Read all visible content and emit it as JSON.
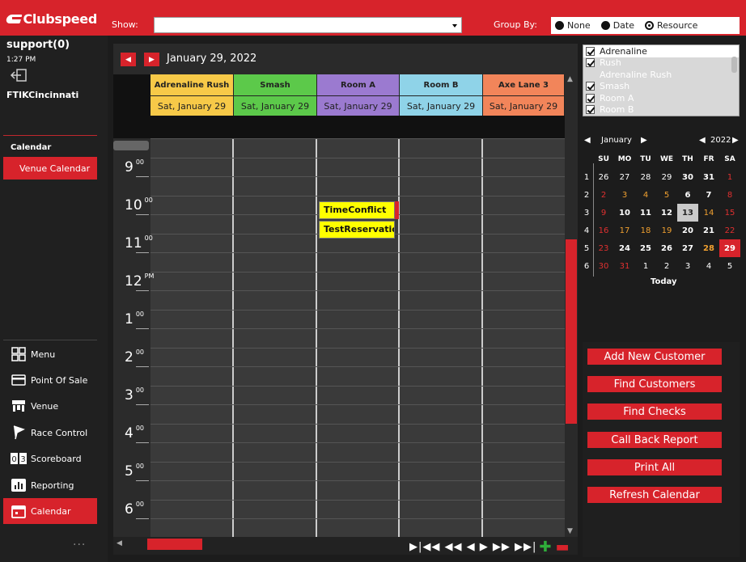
{
  "brand": {
    "name": "Clubspeed",
    "color": "#d7232b"
  },
  "header": {
    "show_label": "Show:",
    "show_value": "",
    "group_by_label": "Group By:",
    "group_by_options": [
      "None",
      "Date",
      "Resource"
    ],
    "group_by_selected": "Resource"
  },
  "sidebar": {
    "user": "support(0)",
    "time": "1:27 PM",
    "location": "FTIKCincinnati",
    "calendar_header": "Calendar",
    "venue_calendar": "Venue Calendar",
    "nav": [
      {
        "label": "Menu",
        "icon": "grid-icon"
      },
      {
        "label": "Point Of Sale",
        "icon": "credit-card-icon"
      },
      {
        "label": "Venue",
        "icon": "venue-icon"
      },
      {
        "label": "Race Control",
        "icon": "flag-icon"
      },
      {
        "label": "Scoreboard",
        "icon": "scoreboard-icon"
      },
      {
        "label": "Reporting",
        "icon": "bar-chart-icon"
      },
      {
        "label": "Calendar",
        "icon": "calendar-icon",
        "active": true
      }
    ],
    "more": "..."
  },
  "calendar": {
    "date_title": "January 29, 2022",
    "resources": [
      {
        "name": "Adrenaline Rush",
        "date": "Sat, January 29",
        "color": "#f7c948"
      },
      {
        "name": "Smash",
        "date": "Sat, January 29",
        "color": "#5cc94a"
      },
      {
        "name": "Room A",
        "date": "Sat, January 29",
        "color": "#9b7ad0"
      },
      {
        "name": "Room B",
        "date": "Sat, January 29",
        "color": "#8fd3e8"
      },
      {
        "name": "Axe Lane 3",
        "date": "Sat, January 29",
        "color": "#f2855a"
      }
    ],
    "hours": [
      {
        "h": "9",
        "s": "00"
      },
      {
        "h": "10",
        "s": "00"
      },
      {
        "h": "11",
        "s": "00"
      },
      {
        "h": "12",
        "s": "PM"
      },
      {
        "h": "1",
        "s": "00"
      },
      {
        "h": "2",
        "s": "00"
      },
      {
        "h": "3",
        "s": "00"
      },
      {
        "h": "4",
        "s": "00"
      },
      {
        "h": "5",
        "s": "00"
      },
      {
        "h": "6",
        "s": "00"
      }
    ],
    "events": [
      {
        "title": "TimeConflict",
        "resource": "Room A"
      },
      {
        "title": "TestReservatio",
        "resource": "Room A"
      }
    ],
    "pager": "▶|◀◀ ◀◀  ◀   ▶  ▶▶ ▶▶|"
  },
  "resource_filter": {
    "items": [
      {
        "label": "Adrenaline",
        "checked": true
      },
      {
        "label": "Rush",
        "checked": true
      },
      {
        "label": "Adrenaline Rush",
        "checked": false
      },
      {
        "label": "Smash",
        "checked": true
      },
      {
        "label": "Room A",
        "checked": true
      },
      {
        "label": "Room B",
        "checked": true
      }
    ]
  },
  "minical": {
    "month": "January",
    "year": "2022",
    "weekdays": [
      "SU",
      "MO",
      "TU",
      "WE",
      "TH",
      "FR",
      "SA"
    ],
    "weeks": [
      {
        "wk": "1",
        "days": [
          "26",
          "27",
          "28",
          "29",
          "30",
          "31",
          "1"
        ]
      },
      {
        "wk": "2",
        "days": [
          "2",
          "3",
          "4",
          "5",
          "6",
          "7",
          "8"
        ]
      },
      {
        "wk": "3",
        "days": [
          "9",
          "10",
          "11",
          "12",
          "13",
          "14",
          "15"
        ]
      },
      {
        "wk": "4",
        "days": [
          "16",
          "17",
          "18",
          "19",
          "20",
          "21",
          "22"
        ]
      },
      {
        "wk": "5",
        "days": [
          "23",
          "24",
          "25",
          "26",
          "27",
          "28",
          "29"
        ]
      },
      {
        "wk": "6",
        "days": [
          "30",
          "31",
          "1",
          "2",
          "3",
          "4",
          "5"
        ]
      }
    ],
    "today_label": "Today"
  },
  "actions": [
    "Add New Customer",
    "Find Customers",
    "Find Checks",
    "Call Back Report",
    "Print All",
    "Refresh Calendar"
  ]
}
